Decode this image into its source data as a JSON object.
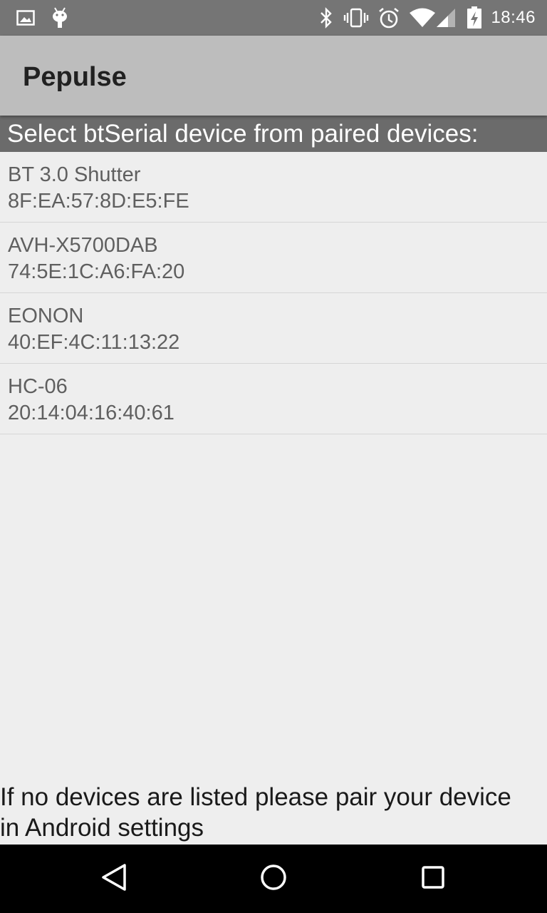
{
  "status_bar": {
    "time": "18:46",
    "left_icons": [
      "image-icon",
      "android-debug-icon"
    ],
    "right_icons": [
      "bluetooth-icon",
      "vibrate-icon",
      "alarm-icon",
      "wifi-icon",
      "cell-signal-icon",
      "battery-charging-icon"
    ]
  },
  "app_bar": {
    "title": "Pepulse"
  },
  "header": {
    "text": "Select btSerial device from paired devices:"
  },
  "devices": [
    {
      "name": "BT 3.0 Shutter",
      "address": "8F:EA:57:8D:E5:FE"
    },
    {
      "name": "AVH-X5700DAB",
      "address": "74:5E:1C:A6:FA:20"
    },
    {
      "name": "EONON",
      "address": "40:EF:4C:11:13:22"
    },
    {
      "name": "HC-06",
      "address": "20:14:04:16:40:61"
    }
  ],
  "footer": {
    "line1": "If no devices are listed please pair your device",
    "line2": "in Android settings"
  },
  "nav": {
    "icons": [
      "back-icon",
      "home-icon",
      "recents-icon"
    ]
  },
  "colors": {
    "status_bar": "#757575",
    "app_bar": "#bdbdbd",
    "header_bg": "#6b6b6b",
    "background": "#eeeeee",
    "nav_bar": "#000000"
  }
}
